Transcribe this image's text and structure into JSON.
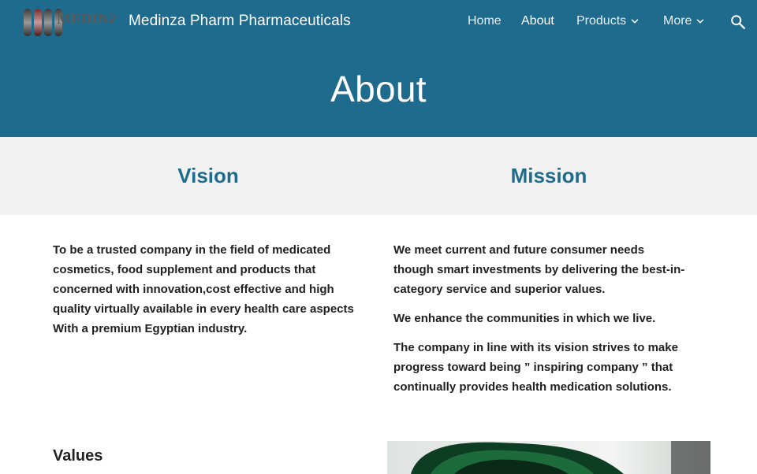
{
  "header": {
    "site_title": "Medinza Pharm Pharmaceuticals",
    "logo_text": "MEDINZA",
    "nav": [
      {
        "label": "Home",
        "active": false,
        "has_dropdown": false
      },
      {
        "label": "About",
        "active": true,
        "has_dropdown": false
      },
      {
        "label": "Products",
        "active": false,
        "has_dropdown": true
      },
      {
        "label": "More",
        "active": false,
        "has_dropdown": true
      }
    ],
    "search_icon": "search-icon"
  },
  "page_title": "About",
  "band": {
    "vision_title": "Vision",
    "mission_title": "Mission"
  },
  "vision_text": "To be a trusted company in the field of medicated cosmetics, food supplement and products that concerned with innovation,cost effective and high quality virtually available in every health care aspects With a premium Egyptian industry.",
  "mission_paragraphs": [
    "We meet current and future consumer needs though smart investments by delivering the best-in-category service and superior values.",
    "We enhance the communities in which we live.",
    "The company in line with its vision strives to make progress toward being ” inspiring company ” that continually provides health medication solutions."
  ],
  "values_heading": "Values",
  "colors": {
    "brand": "#1f6b8e",
    "band_bg": "#f2f2f2",
    "text": "#212121"
  }
}
